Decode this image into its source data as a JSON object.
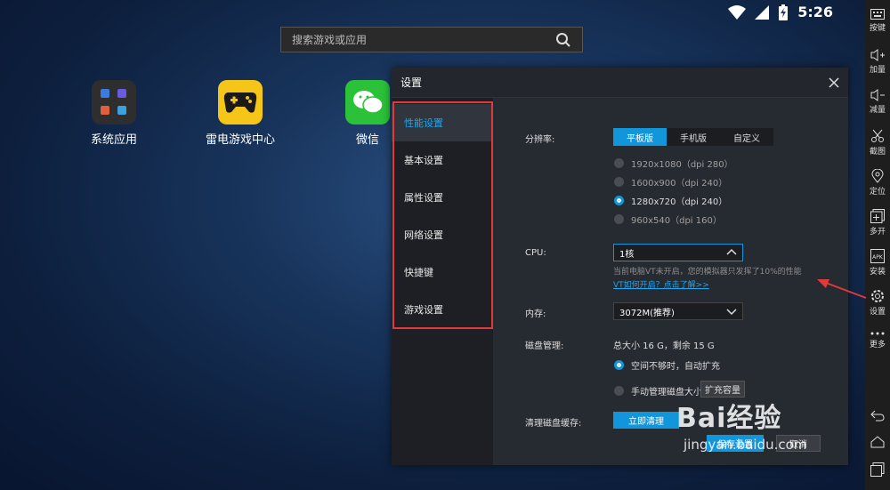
{
  "status": {
    "time": "5:26"
  },
  "search": {
    "placeholder": "搜索游戏或应用"
  },
  "apps": [
    {
      "label": "系统应用"
    },
    {
      "label": "雷电游戏中心"
    },
    {
      "label": "微信"
    }
  ],
  "toolbar": {
    "items": [
      "按键",
      "加量",
      "减量",
      "截图",
      "定位",
      "多开",
      "安装",
      "设置",
      "更多"
    ]
  },
  "dialog": {
    "title": "设置",
    "nav": [
      "性能设置",
      "基本设置",
      "属性设置",
      "网络设置",
      "快捷键",
      "游戏设置"
    ],
    "active_nav": "性能设置",
    "resolution": {
      "label": "分辨率:",
      "tabs": [
        "平板版",
        "手机版",
        "自定义"
      ],
      "selected_tab": "平板版",
      "options": [
        "1920x1080（dpi 280）",
        "1600x900（dpi 240）",
        "1280x720（dpi 240）",
        "960x540（dpi 160）"
      ],
      "selected_option": "1280x720（dpi 240）"
    },
    "cpu": {
      "label": "CPU:",
      "value": "1核",
      "hint": "当前电脑VT未开启，您的模拟器只发挥了10%的性能",
      "link": "VT如何开启？点击了解>>"
    },
    "memory": {
      "label": "内存:",
      "value": "3072M(推荐)"
    },
    "disk": {
      "label": "磁盘管理:",
      "summary": "总大小 16 G，剩余 15 G",
      "option_auto": "空间不够时，自动扩充",
      "option_manual": "手动管理磁盘大小",
      "expand_button": "扩充容量"
    },
    "cache": {
      "label": "清理磁盘缓存:",
      "button": "立即清理"
    },
    "footer": {
      "save": "保存设置",
      "cancel": "取消"
    }
  },
  "watermark": {
    "brand": "Bai经验",
    "url": "jingyan.baidu.com"
  },
  "colors": {
    "accent": "#1296db",
    "highlight_outline": "#e03a3a",
    "arrow": "#e03a3a"
  }
}
